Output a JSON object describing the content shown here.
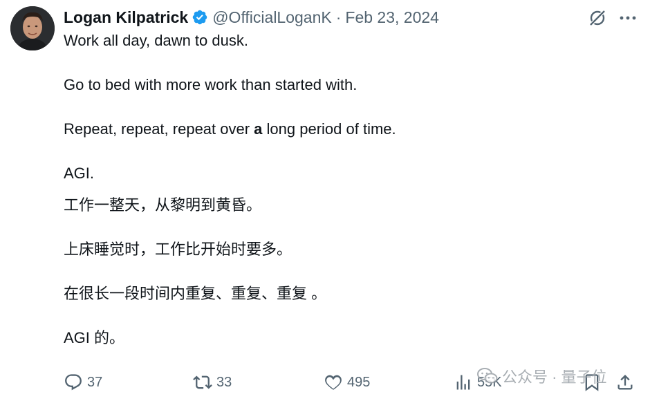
{
  "author": {
    "name": "Logan Kilpatrick",
    "handle": "@OfficialLoganK",
    "separator": "·",
    "date": "Feb 23, 2024",
    "verified_color": "#1d9bf0"
  },
  "tweet": {
    "english": [
      {
        "text": "Work all day, dawn to dusk."
      },
      {
        "text": "Go to bed with more work than started with."
      },
      {
        "before": "Repeat, repeat, repeat over ",
        "bold": "a",
        "after": " long period of time."
      },
      {
        "text": "AGI."
      }
    ],
    "chinese": [
      "工作一整天，从黎明到黄昏。",
      "上床睡觉时，工作比开始时要多。",
      "在很长一段时间内重复、重复、重复 。",
      "AGI 的。"
    ]
  },
  "actions": {
    "replies": "37",
    "reposts": "33",
    "likes": "495",
    "views": "55K"
  },
  "watermark": {
    "text": "公众号 · 量子位"
  },
  "icons": [
    "verified-badge-icon",
    "grok-icon",
    "more-icon",
    "reply-icon",
    "repost-icon",
    "like-icon",
    "views-icon",
    "bookmark-icon",
    "share-icon",
    "wechat-icon"
  ]
}
